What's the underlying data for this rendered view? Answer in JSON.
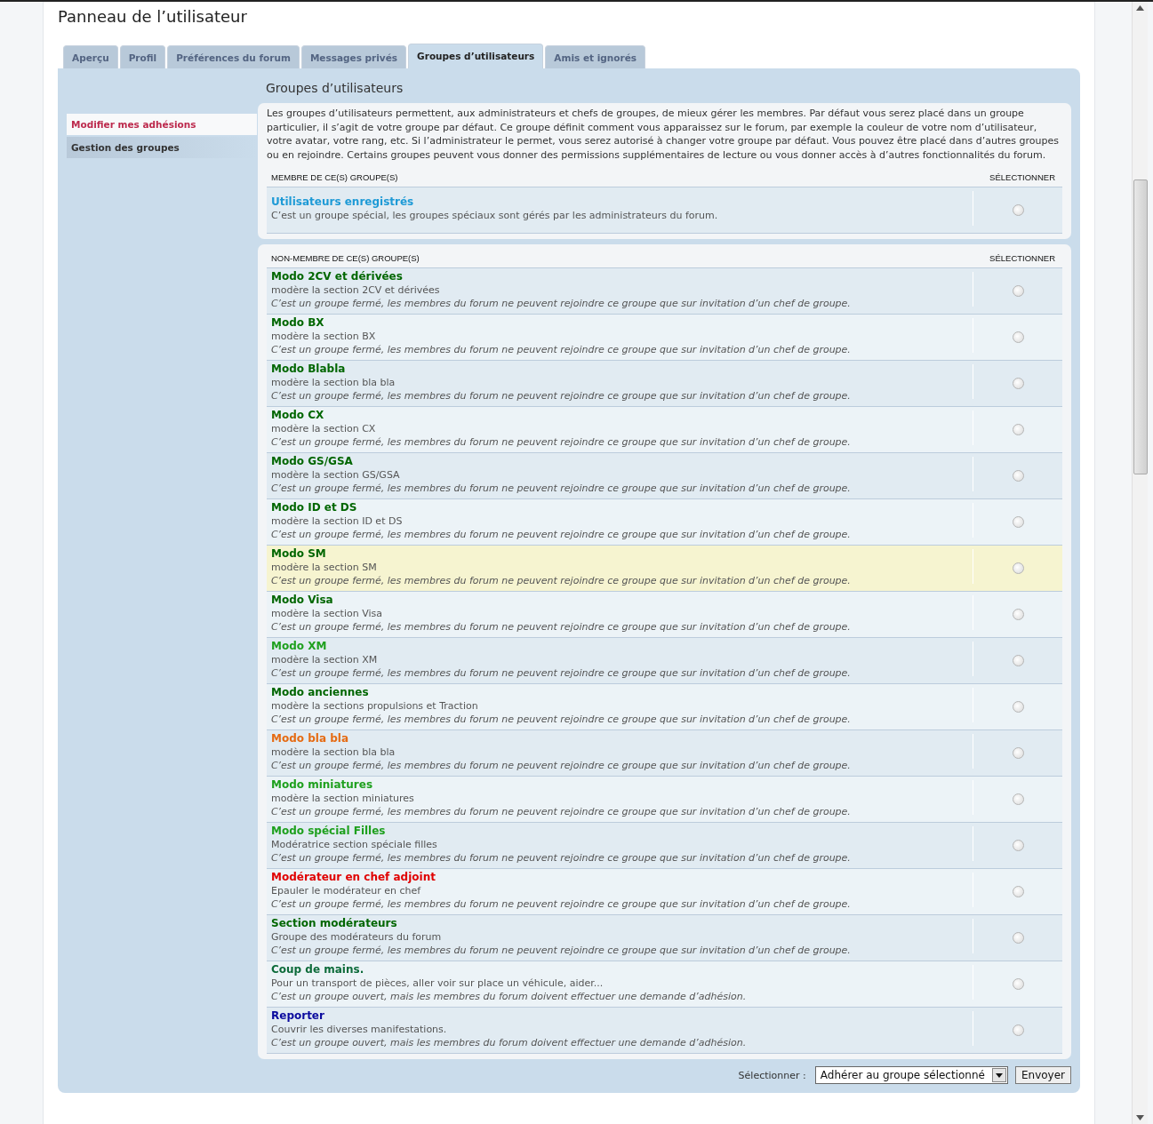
{
  "page_title": "Panneau de l’utilisateur",
  "tabs": [
    {
      "label": "Aperçu",
      "selected": false
    },
    {
      "label": "Profil",
      "selected": false
    },
    {
      "label": "Préférences du forum",
      "selected": false
    },
    {
      "label": "Messages privés",
      "selected": false
    },
    {
      "label": "Groupes d’utilisateurs",
      "selected": true
    },
    {
      "label": "Amis et ignorés",
      "selected": false
    }
  ],
  "sidebar": {
    "items": [
      {
        "label": "Modifier mes adhésions",
        "selected": true
      },
      {
        "label": "Gestion des groupes",
        "selected": false
      }
    ]
  },
  "section_title": "Groupes d’utilisateurs",
  "intro": "Les groupes d’utilisateurs permettent, aux administrateurs et chefs de groupes, de mieux gérer les membres. Par défaut vous serez placé dans un groupe particulier, il s’agit de votre groupe par défaut. Ce groupe définit comment vous apparaissez sur le forum, par exemple la couleur de votre nom d’utilisateur, votre avatar, votre rang, etc. Si l’administrateur le permet, vous serez autorisé à changer votre groupe par défaut. Vous pouvez être placé dans d’autres groupes ou en rejoindre. Certains groupes peuvent vous donner des permissions supplémentaires de lecture ou vous donner accès à d’autres fonctionnalités du forum.",
  "tables": [
    {
      "heading": "MEMBRE DE CE(S) GROUPE(S)",
      "select_heading": "SÉLECTIONNER",
      "rows": [
        {
          "name": "Utilisateurs enregistrés",
          "color": "#1e9ad6",
          "description": "C’est un groupe spécial, les groupes spéciaux sont gérés par les administrateurs du forum.",
          "hovered": false,
          "selected": false
        }
      ]
    },
    {
      "heading": "NON-MEMBRE DE CE(S) GROUPE(S)",
      "select_heading": "SÉLECTIONNER",
      "rows": [
        {
          "name": "Modo 2CV et dérivées",
          "color": "#006600",
          "description": "modère la section 2CV et dérivées",
          "note": "C’est un groupe fermé, les membres du forum ne peuvent rejoindre ce groupe que sur invitation d’un chef de groupe.",
          "hovered": false,
          "selected": false
        },
        {
          "name": "Modo BX",
          "color": "#006600",
          "description": "modère la section BX",
          "note": "C’est un groupe fermé, les membres du forum ne peuvent rejoindre ce groupe que sur invitation d’un chef de groupe.",
          "hovered": false,
          "selected": false
        },
        {
          "name": "Modo Blabla",
          "color": "#006600",
          "description": "modère la section bla bla",
          "note": "C’est un groupe fermé, les membres du forum ne peuvent rejoindre ce groupe que sur invitation d’un chef de groupe.",
          "hovered": false,
          "selected": false
        },
        {
          "name": "Modo CX",
          "color": "#006600",
          "description": "modère la section CX",
          "note": "C’est un groupe fermé, les membres du forum ne peuvent rejoindre ce groupe que sur invitation d’un chef de groupe.",
          "hovered": false,
          "selected": false
        },
        {
          "name": "Modo GS/GSA",
          "color": "#006600",
          "description": "modère la section GS/GSA",
          "note": "C’est un groupe fermé, les membres du forum ne peuvent rejoindre ce groupe que sur invitation d’un chef de groupe.",
          "hovered": false,
          "selected": false
        },
        {
          "name": "Modo ID et DS",
          "color": "#006600",
          "description": "modère la section ID et DS",
          "note": "C’est un groupe fermé, les membres du forum ne peuvent rejoindre ce groupe que sur invitation d’un chef de groupe.",
          "hovered": false,
          "selected": false
        },
        {
          "name": "Modo SM",
          "color": "#006600",
          "description": "modère la section SM",
          "note": "C’est un groupe fermé, les membres du forum ne peuvent rejoindre ce groupe que sur invitation d’un chef de groupe.",
          "hovered": true,
          "selected": false
        },
        {
          "name": "Modo Visa",
          "color": "#006600",
          "description": "modère la section Visa",
          "note": "C’est un groupe fermé, les membres du forum ne peuvent rejoindre ce groupe que sur invitation d’un chef de groupe.",
          "hovered": false,
          "selected": false
        },
        {
          "name": "Modo XM",
          "color": "#1ea01e",
          "description": "modère la section XM",
          "note": "C’est un groupe fermé, les membres du forum ne peuvent rejoindre ce groupe que sur invitation d’un chef de groupe.",
          "hovered": false,
          "selected": false
        },
        {
          "name": "Modo anciennes",
          "color": "#006600",
          "description": "modère la sections propulsions et Traction",
          "note": "C’est un groupe fermé, les membres du forum ne peuvent rejoindre ce groupe que sur invitation d’un chef de groupe.",
          "hovered": false,
          "selected": false
        },
        {
          "name": "Modo bla bla",
          "color": "#e56b13",
          "description": "modère la section bla bla",
          "note": "C’est un groupe fermé, les membres du forum ne peuvent rejoindre ce groupe que sur invitation d’un chef de groupe.",
          "hovered": false,
          "selected": false
        },
        {
          "name": "Modo miniatures",
          "color": "#1ea01e",
          "description": "modère la section miniatures",
          "note": "C’est un groupe fermé, les membres du forum ne peuvent rejoindre ce groupe que sur invitation d’un chef de groupe.",
          "hovered": false,
          "selected": false
        },
        {
          "name": "Modo spécial Filles",
          "color": "#1ea01e",
          "description": "Modératrice section spéciale filles",
          "note": "C’est un groupe fermé, les membres du forum ne peuvent rejoindre ce groupe que sur invitation d’un chef de groupe.",
          "hovered": false,
          "selected": false
        },
        {
          "name": "Modérateur en chef adjoint",
          "color": "#e00000",
          "description": "Epauler le modérateur en chef",
          "note": "C’est un groupe fermé, les membres du forum ne peuvent rejoindre ce groupe que sur invitation d’un chef de groupe.",
          "hovered": false,
          "selected": false
        },
        {
          "name": "Section modérateurs",
          "color": "#006600",
          "description": "Groupe des modérateurs du forum",
          "note": "C’est un groupe fermé, les membres du forum ne peuvent rejoindre ce groupe que sur invitation d’un chef de groupe.",
          "hovered": false,
          "selected": false
        },
        {
          "name": "Coup de mains.",
          "color": "#0d6b3a",
          "description": "Pour un transport de pièces, aller voir sur place un véhicule, aider...",
          "note": "C’est un groupe ouvert, mais les membres du forum doivent effectuer une demande d’adhésion.",
          "hovered": false,
          "selected": false
        },
        {
          "name": "Reporter",
          "color": "#0a0a9e",
          "description": "Couvrir les diverses manifestations.",
          "note": "C’est un groupe ouvert, mais les membres du forum doivent effectuer une demande d’adhésion.",
          "hovered": false,
          "selected": false
        }
      ]
    }
  ],
  "footer": {
    "label": "Sélectionner :",
    "select_value": "Adhérer au groupe sélectionné",
    "button": "Envoyer"
  }
}
